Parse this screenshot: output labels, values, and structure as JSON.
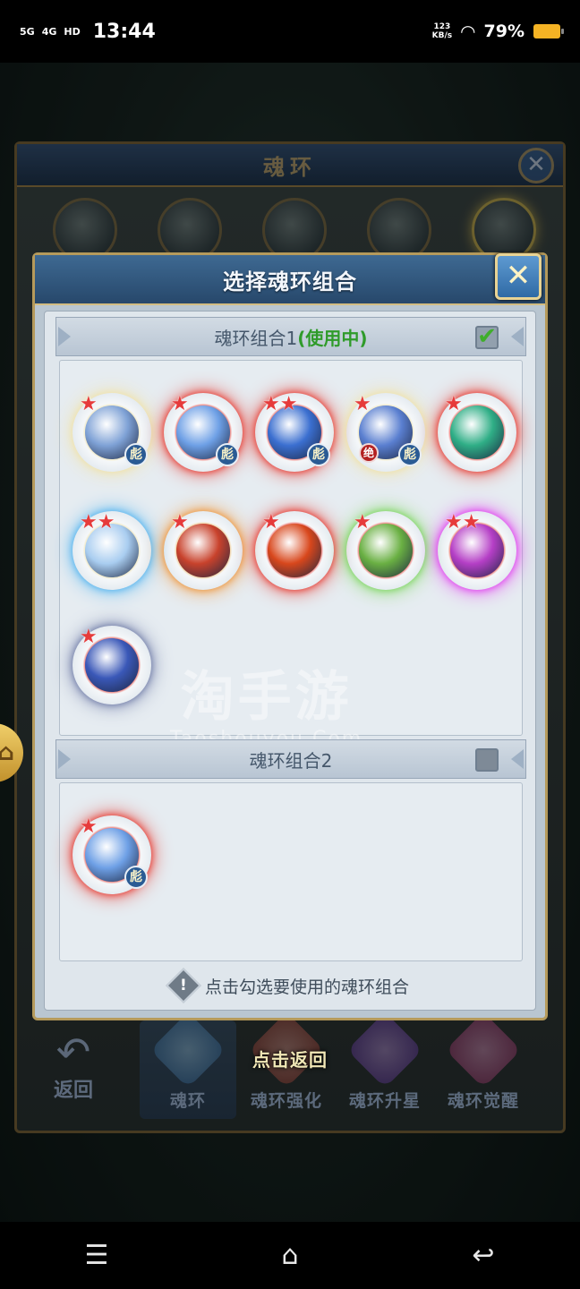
{
  "status_bar": {
    "signal_1": "5G",
    "signal_2": "4G",
    "hd": "HD",
    "time": "13:44",
    "net_speed_value": "123",
    "net_speed_unit": "KB/s",
    "battery_percent": "79%"
  },
  "background_screen": {
    "title": "魂环",
    "close_glyph": "✕",
    "back_label": "返回",
    "nav_tabs": [
      {
        "label": "魂环",
        "gem_color": "#5fa8d9",
        "active": true
      },
      {
        "label": "魂环强化",
        "gem_color": "#d95f4d",
        "active": false
      },
      {
        "label": "魂环升星",
        "gem_color": "#a05fd9",
        "active": false
      },
      {
        "label": "魂环觉醒",
        "gem_color": "#d95fa8",
        "active": false
      }
    ],
    "click_return": "点击返回"
  },
  "dialog": {
    "title": "选择魂环组合",
    "close_glyph": "✕",
    "group1": {
      "title": "魂环组合1",
      "status": "(使用中)",
      "checked": true,
      "check_glyph": "✔",
      "rings": [
        {
          "ring": "#f1e2a6",
          "core": "#7fa2d6",
          "star": "★",
          "tag": "彪"
        },
        {
          "ring": "#e8392f",
          "core": "#6ea0e6",
          "star": "★",
          "tag": "彪"
        },
        {
          "ring": "#e8392f",
          "core": "#3b6fd0",
          "star": "★★",
          "tag": "彪"
        },
        {
          "ring": "#f1e2a6",
          "core": "#5a7fd0",
          "star": "★",
          "tag": "彪",
          "badge": "绝"
        },
        {
          "ring": "#e8392f",
          "core": "#2fae86",
          "star": "★"
        },
        {
          "ring": "#f1e2a6",
          "core": "#a9cdf0",
          "star": "★★",
          "glow": "#4fb3f0"
        },
        {
          "ring": "#f1c072",
          "core": "#c8422c",
          "star": "★",
          "glow": "#f0963a"
        },
        {
          "ring": "#e8392f",
          "core": "#d8471c",
          "star": "★"
        },
        {
          "ring": "#e8392f",
          "core": "#6ab043",
          "star": "★",
          "glow": "#7ad65a"
        },
        {
          "ring": "#e8392f",
          "core": "#b53fc6",
          "star": "★★",
          "glow": "#e23cf0"
        },
        {
          "ring": "#e8392f",
          "core": "#3a58b8",
          "star": "★",
          "glow": "#6e7aa6"
        }
      ]
    },
    "group2": {
      "title": "魂环组合2",
      "checked": false,
      "rings": [
        {
          "ring": "#e8392f",
          "core": "#6ea0e6",
          "star": "★",
          "tag": "彪"
        }
      ]
    },
    "hint_icon": "!",
    "hint": "点击勾选要使用的魂环组合"
  },
  "watermark": {
    "brand": "淘手游",
    "domain": "Taoshouyou.Com"
  },
  "system_nav": {
    "menu_glyph": "☰",
    "home_glyph": "⌂",
    "back_glyph": "↩"
  }
}
